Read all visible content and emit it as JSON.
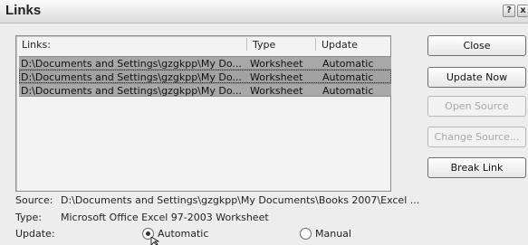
{
  "window": {
    "title": "Links",
    "help_glyph": "?",
    "close_glyph": "x"
  },
  "list": {
    "headers": [
      "Links:",
      "Type",
      "Update"
    ],
    "rows": [
      {
        "link": "D:\\Documents and Settings\\gzgkpp\\My Do...",
        "type": "Worksheet",
        "update": "Automatic"
      },
      {
        "link": "D:\\Documents and Settings\\gzgkpp\\My Do...",
        "type": "Worksheet",
        "update": "Automatic"
      },
      {
        "link": "D:\\Documents and Settings\\gzgkpp\\My Do...",
        "type": "Worksheet",
        "update": "Automatic"
      }
    ]
  },
  "buttons": {
    "close": "Close",
    "update_now": "Update Now",
    "open_source": "Open Source",
    "change_source": "Change Source...",
    "break_link": "Break Link"
  },
  "details": {
    "source_label": "Source:",
    "source_value": "D:\\Documents and Settings\\gzgkpp\\My Documents\\Books 2007\\Excel ...",
    "type_label": "Type:",
    "type_value": "Microsoft Office Excel 97-2003 Worksheet",
    "update_label": "Update:",
    "option_automatic": "Automatic",
    "option_manual": "Manual"
  }
}
